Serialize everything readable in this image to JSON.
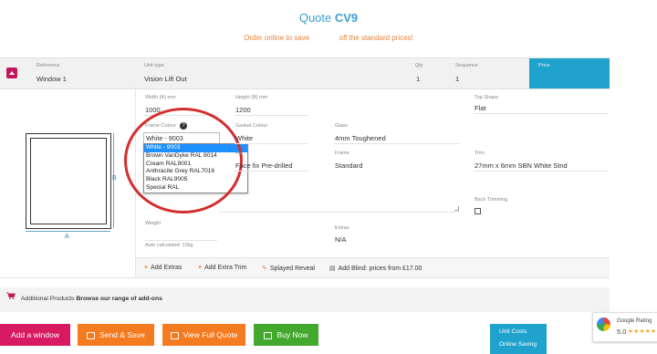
{
  "quote": {
    "label": "Quote",
    "code": "CV9"
  },
  "promo": {
    "part1": "Order online to save",
    "part2": "off the standard prices!"
  },
  "header": {
    "reference_label": "Reference",
    "reference_value": "Window 1",
    "unit_type_label": "Unit type",
    "unit_type_value": "Vision Lift Out",
    "qty_label": "Qty",
    "qty_value": "1",
    "sequence_label": "Sequence",
    "sequence_value": "1",
    "price_label": "Price"
  },
  "diagram": {
    "dim_a": "A",
    "dim_b": "B"
  },
  "fields": {
    "width_label": "Width (A) mm",
    "width_value": "1000",
    "height_label": "Height (B) mm",
    "height_value": "1200",
    "top_shape_label": "Top Shape",
    "top_shape_value": "Flat",
    "frame_colour_label": "Frame Colour",
    "frame_colour_value": "White - 9003",
    "gasket_colour_label": "Gasket Colour",
    "gasket_colour_value": "White",
    "glass_label": "Glass",
    "glass_value": "4mm Toughened",
    "fix_label": "Fix",
    "fix_value": "Face fix Pre-drilled",
    "frame_label": "Frame",
    "frame_value": "Standard",
    "trim_label": "Trim",
    "trim_value": "27mm x 6mm SBN White Stnd",
    "back_trimming_label": "Back Trimming",
    "weight_label": "Weight",
    "weight_note": "Auto calculated: 12kg",
    "extras_label": "Extras",
    "extras_value": "N/A"
  },
  "frame_colour_options": [
    "White - 9003",
    "Brown VanDyke RAL 8014",
    "Cream RAL9001",
    "Anthracite Grey RAL7016",
    "Black RAL9005",
    "Special RAL"
  ],
  "extras_bar": {
    "add_extras": "Add Extras",
    "add_extra_trim": "Add Extra Trim",
    "splayed_reveal": "Splayed Reveal",
    "add_blind": "Add Blind: prices from £17.00"
  },
  "additional": {
    "label": "Additional Products",
    "link": "Browse our range of add-ons"
  },
  "buttons": {
    "add_window": "Add a window",
    "send_save": "Send & Save",
    "view_quote": "View Full Quote",
    "buy_now": "Buy Now"
  },
  "unit_costs": {
    "title": "Unit Costs",
    "online_saving": "Online Saving"
  },
  "google_rating": {
    "label": "Google Rating",
    "score": "5.0",
    "stars": "★★★★★"
  },
  "colors": {
    "accent_blue": "#1fa3cc",
    "orange": "#e6823a",
    "magenta": "#c2185b",
    "highlight_circle": "#d32f2f",
    "btn_pink": "#d81b60",
    "btn_orange": "#f47b20",
    "btn_green": "#43a82e"
  }
}
